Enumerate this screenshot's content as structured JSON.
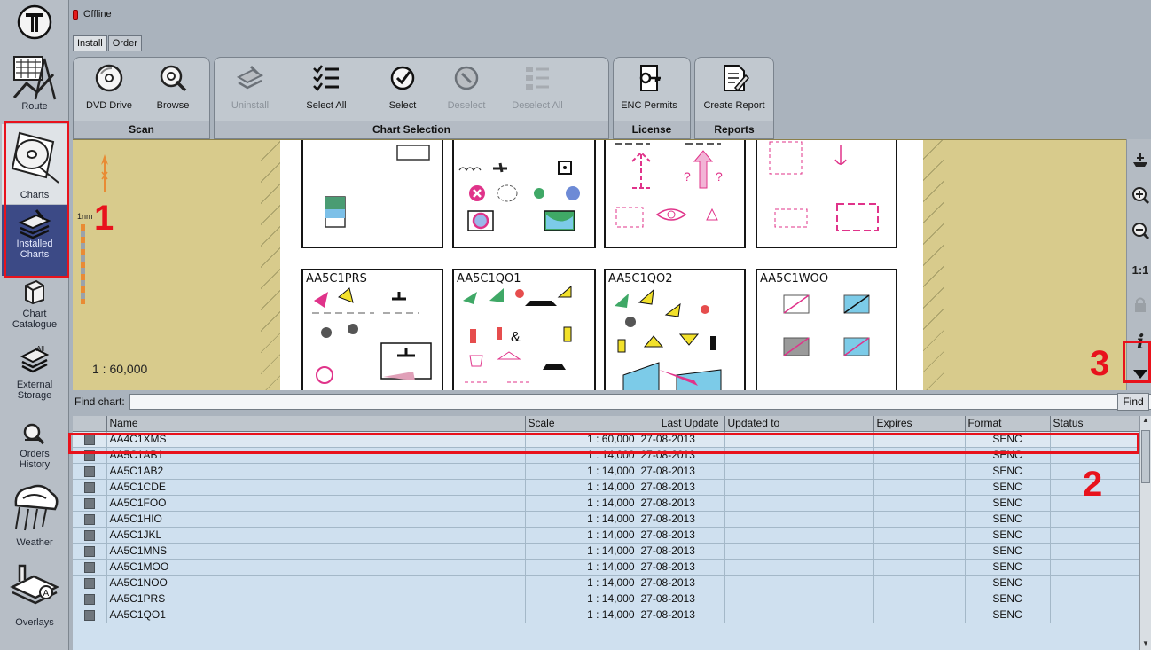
{
  "status": {
    "text": "Offline"
  },
  "tabs": [
    {
      "label": "Install"
    },
    {
      "label": "Order"
    }
  ],
  "sidebar": {
    "route": "Route",
    "charts": "Charts",
    "installed": "Installed Charts",
    "catalogue": "Chart Catalogue",
    "external": "External Storage",
    "orders": "Orders History",
    "weather": "Weather",
    "overlays": "Overlays"
  },
  "ribbon": {
    "scan": {
      "title": "Scan",
      "dvd": "DVD Drive",
      "browse": "Browse"
    },
    "selection": {
      "title": "Chart Selection",
      "uninstall": "Uninstall",
      "select_all": "Select All",
      "select": "Select",
      "deselect": "Deselect",
      "deselect_all": "Deselect All"
    },
    "license": {
      "title": "License",
      "enc_permits": "ENC Permits"
    },
    "reports": {
      "title": "Reports",
      "create_report": "Create Report"
    }
  },
  "map": {
    "scale": "1 : 60,000",
    "unit": "1nm",
    "cells": [
      "AA5C1PRS",
      "AA5C1QO1",
      "AA5C1QO2",
      "AA5C1WOO"
    ]
  },
  "right_toolbar": {
    "one_to_one": "1:1",
    "info": "i"
  },
  "find": {
    "label": "Find chart:",
    "value": "",
    "button": "Find"
  },
  "table": {
    "columns": [
      "Name",
      "Scale",
      "Last Update",
      "Updated to",
      "Expires",
      "Format",
      "Status"
    ],
    "rows": [
      {
        "name": "AA4C1XMS",
        "scale": "1 : 60,000",
        "last_update": "27-08-2013",
        "updated_to": "",
        "expires": "",
        "format": "SENC",
        "status": ""
      },
      {
        "name": "AA5C1AB1",
        "scale": "1 : 14,000",
        "last_update": "27-08-2013",
        "updated_to": "",
        "expires": "",
        "format": "SENC",
        "status": ""
      },
      {
        "name": "AA5C1AB2",
        "scale": "1 : 14,000",
        "last_update": "27-08-2013",
        "updated_to": "",
        "expires": "",
        "format": "SENC",
        "status": ""
      },
      {
        "name": "AA5C1CDE",
        "scale": "1 : 14,000",
        "last_update": "27-08-2013",
        "updated_to": "",
        "expires": "",
        "format": "SENC",
        "status": ""
      },
      {
        "name": "AA5C1FOO",
        "scale": "1 : 14,000",
        "last_update": "27-08-2013",
        "updated_to": "",
        "expires": "",
        "format": "SENC",
        "status": ""
      },
      {
        "name": "AA5C1HIO",
        "scale": "1 : 14,000",
        "last_update": "27-08-2013",
        "updated_to": "",
        "expires": "",
        "format": "SENC",
        "status": ""
      },
      {
        "name": "AA5C1JKL",
        "scale": "1 : 14,000",
        "last_update": "27-08-2013",
        "updated_to": "",
        "expires": "",
        "format": "SENC",
        "status": ""
      },
      {
        "name": "AA5C1MNS",
        "scale": "1 : 14,000",
        "last_update": "27-08-2013",
        "updated_to": "",
        "expires": "",
        "format": "SENC",
        "status": ""
      },
      {
        "name": "AA5C1MOO",
        "scale": "1 : 14,000",
        "last_update": "27-08-2013",
        "updated_to": "",
        "expires": "",
        "format": "SENC",
        "status": ""
      },
      {
        "name": "AA5C1NOO",
        "scale": "1 : 14,000",
        "last_update": "27-08-2013",
        "updated_to": "",
        "expires": "",
        "format": "SENC",
        "status": ""
      },
      {
        "name": "AA5C1PRS",
        "scale": "1 : 14,000",
        "last_update": "27-08-2013",
        "updated_to": "",
        "expires": "",
        "format": "SENC",
        "status": ""
      },
      {
        "name": "AA5C1QO1",
        "scale": "1 : 14,000",
        "last_update": "27-08-2013",
        "updated_to": "",
        "expires": "",
        "format": "SENC",
        "status": ""
      }
    ]
  },
  "callouts": [
    "1",
    "2",
    "3"
  ],
  "colors": {
    "highlight": "#e8121c",
    "selected_nav": "#3c4a86",
    "land": "#d8cb8c",
    "table_bg": "#cfe0ef"
  },
  "icons": [
    "tecdis-logo-icon",
    "route-icon",
    "charts-disc-icon",
    "installed-charts-icon",
    "catalogue-icon",
    "external-storage-icon",
    "orders-history-icon",
    "weather-icon",
    "overlays-icon",
    "info-icon",
    "zoom-in-icon",
    "zoom-out-icon"
  ]
}
